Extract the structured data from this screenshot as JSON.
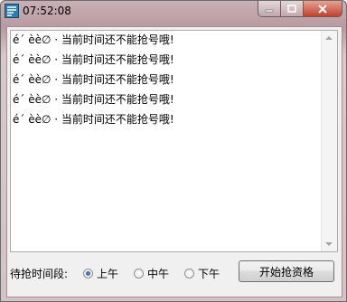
{
  "window": {
    "title": "07:52:08",
    "icon": "app-icon",
    "colors": {
      "close": "#c2412d",
      "titlebar": "#b89aa0"
    }
  },
  "log": {
    "lines": [
      "é´ èè∅ · 当前时间还不能抢号哦!",
      "é´ èè∅ · 当前时间还不能抢号哦!",
      "é´ èè∅ · 当前时间还不能抢号哦!",
      "é´ èè∅ · 当前时间还不能抢号哦!",
      "é´ èè∅ · 当前时间还不能抢号哦!"
    ]
  },
  "controls": {
    "wait_label": "待抢时间段:",
    "options": [
      {
        "label": "上午",
        "checked": true
      },
      {
        "label": "中午",
        "checked": false
      },
      {
        "label": "下午",
        "checked": false
      }
    ],
    "start_button": "开始抢资格"
  }
}
